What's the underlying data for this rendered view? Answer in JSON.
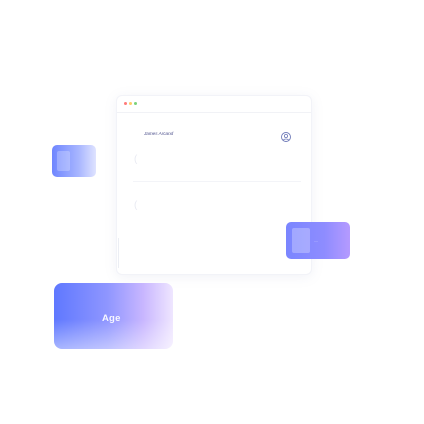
{
  "window": {
    "name": "James Arcand",
    "dot_colors": [
      "#ff7a7a",
      "#ffcc66",
      "#7ad27a"
    ]
  },
  "rows": {
    "mark": "("
  },
  "cards": {
    "age_label": "Age",
    "right_faint_label": "—",
    "gradient_colors": [
      "#5f78ff",
      "#8f96ff",
      "#c8b6ff"
    ]
  },
  "icons": {
    "user": "user-circle-icon",
    "window_controls": "traffic-light-dots"
  }
}
